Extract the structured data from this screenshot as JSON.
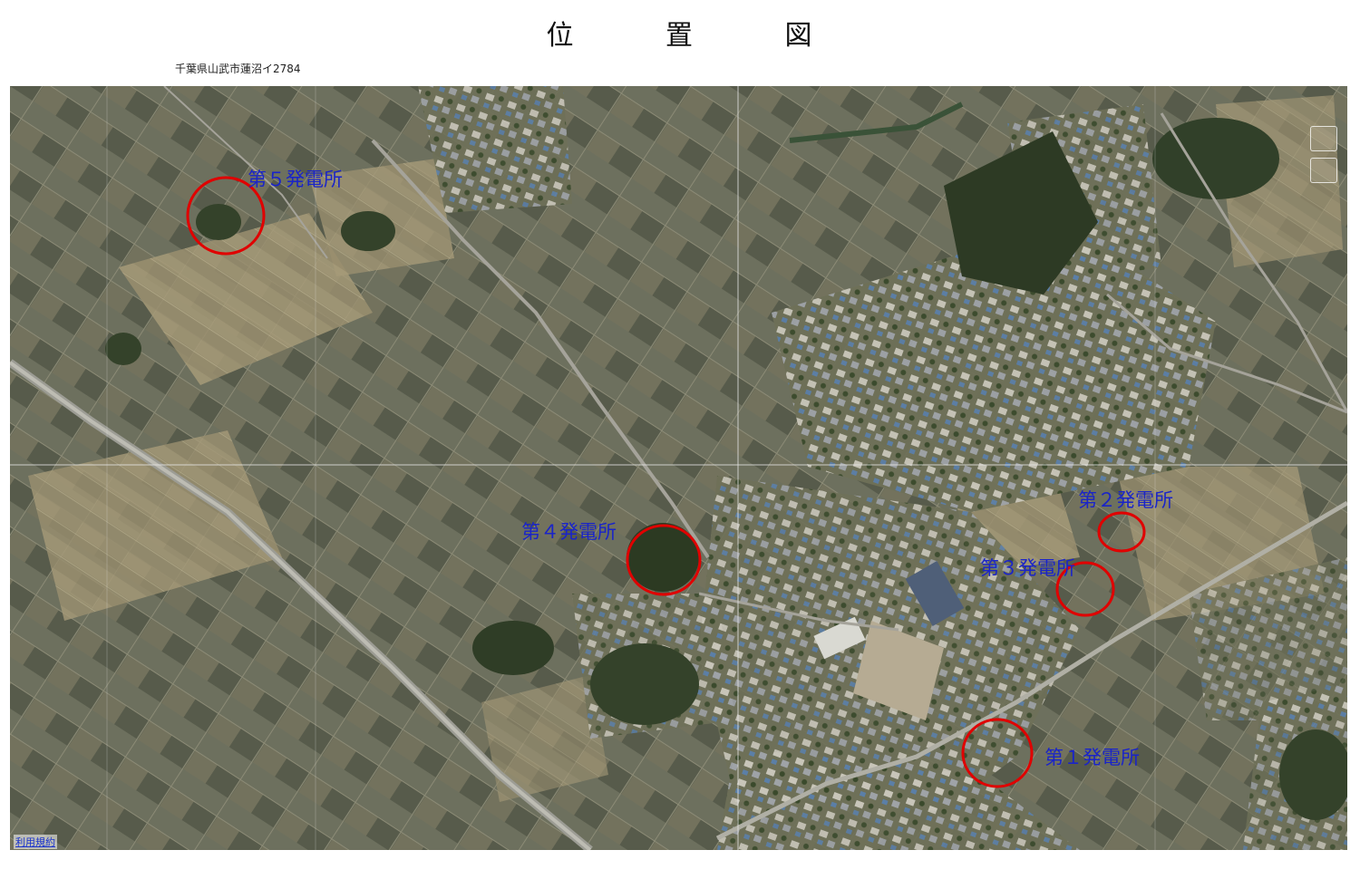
{
  "title": {
    "chars": [
      "位",
      "置",
      "図"
    ]
  },
  "address": "千葉県山武市蓮沼イ2784",
  "map": {
    "type": "aerial-photo",
    "terms_link": "利用規約",
    "controls": [
      "map-control-1",
      "map-control-2"
    ]
  },
  "sites": [
    {
      "id": "site-1",
      "label": "第１発電所",
      "marker_color": "#e00000"
    },
    {
      "id": "site-2",
      "label": "第２発電所",
      "marker_color": "#e00000"
    },
    {
      "id": "site-3",
      "label": "第３発電所",
      "marker_color": "#e00000"
    },
    {
      "id": "site-4",
      "label": "第４発電所",
      "marker_color": "#e00000"
    },
    {
      "id": "site-5",
      "label": "第５発電所",
      "marker_color": "#e00000"
    }
  ]
}
